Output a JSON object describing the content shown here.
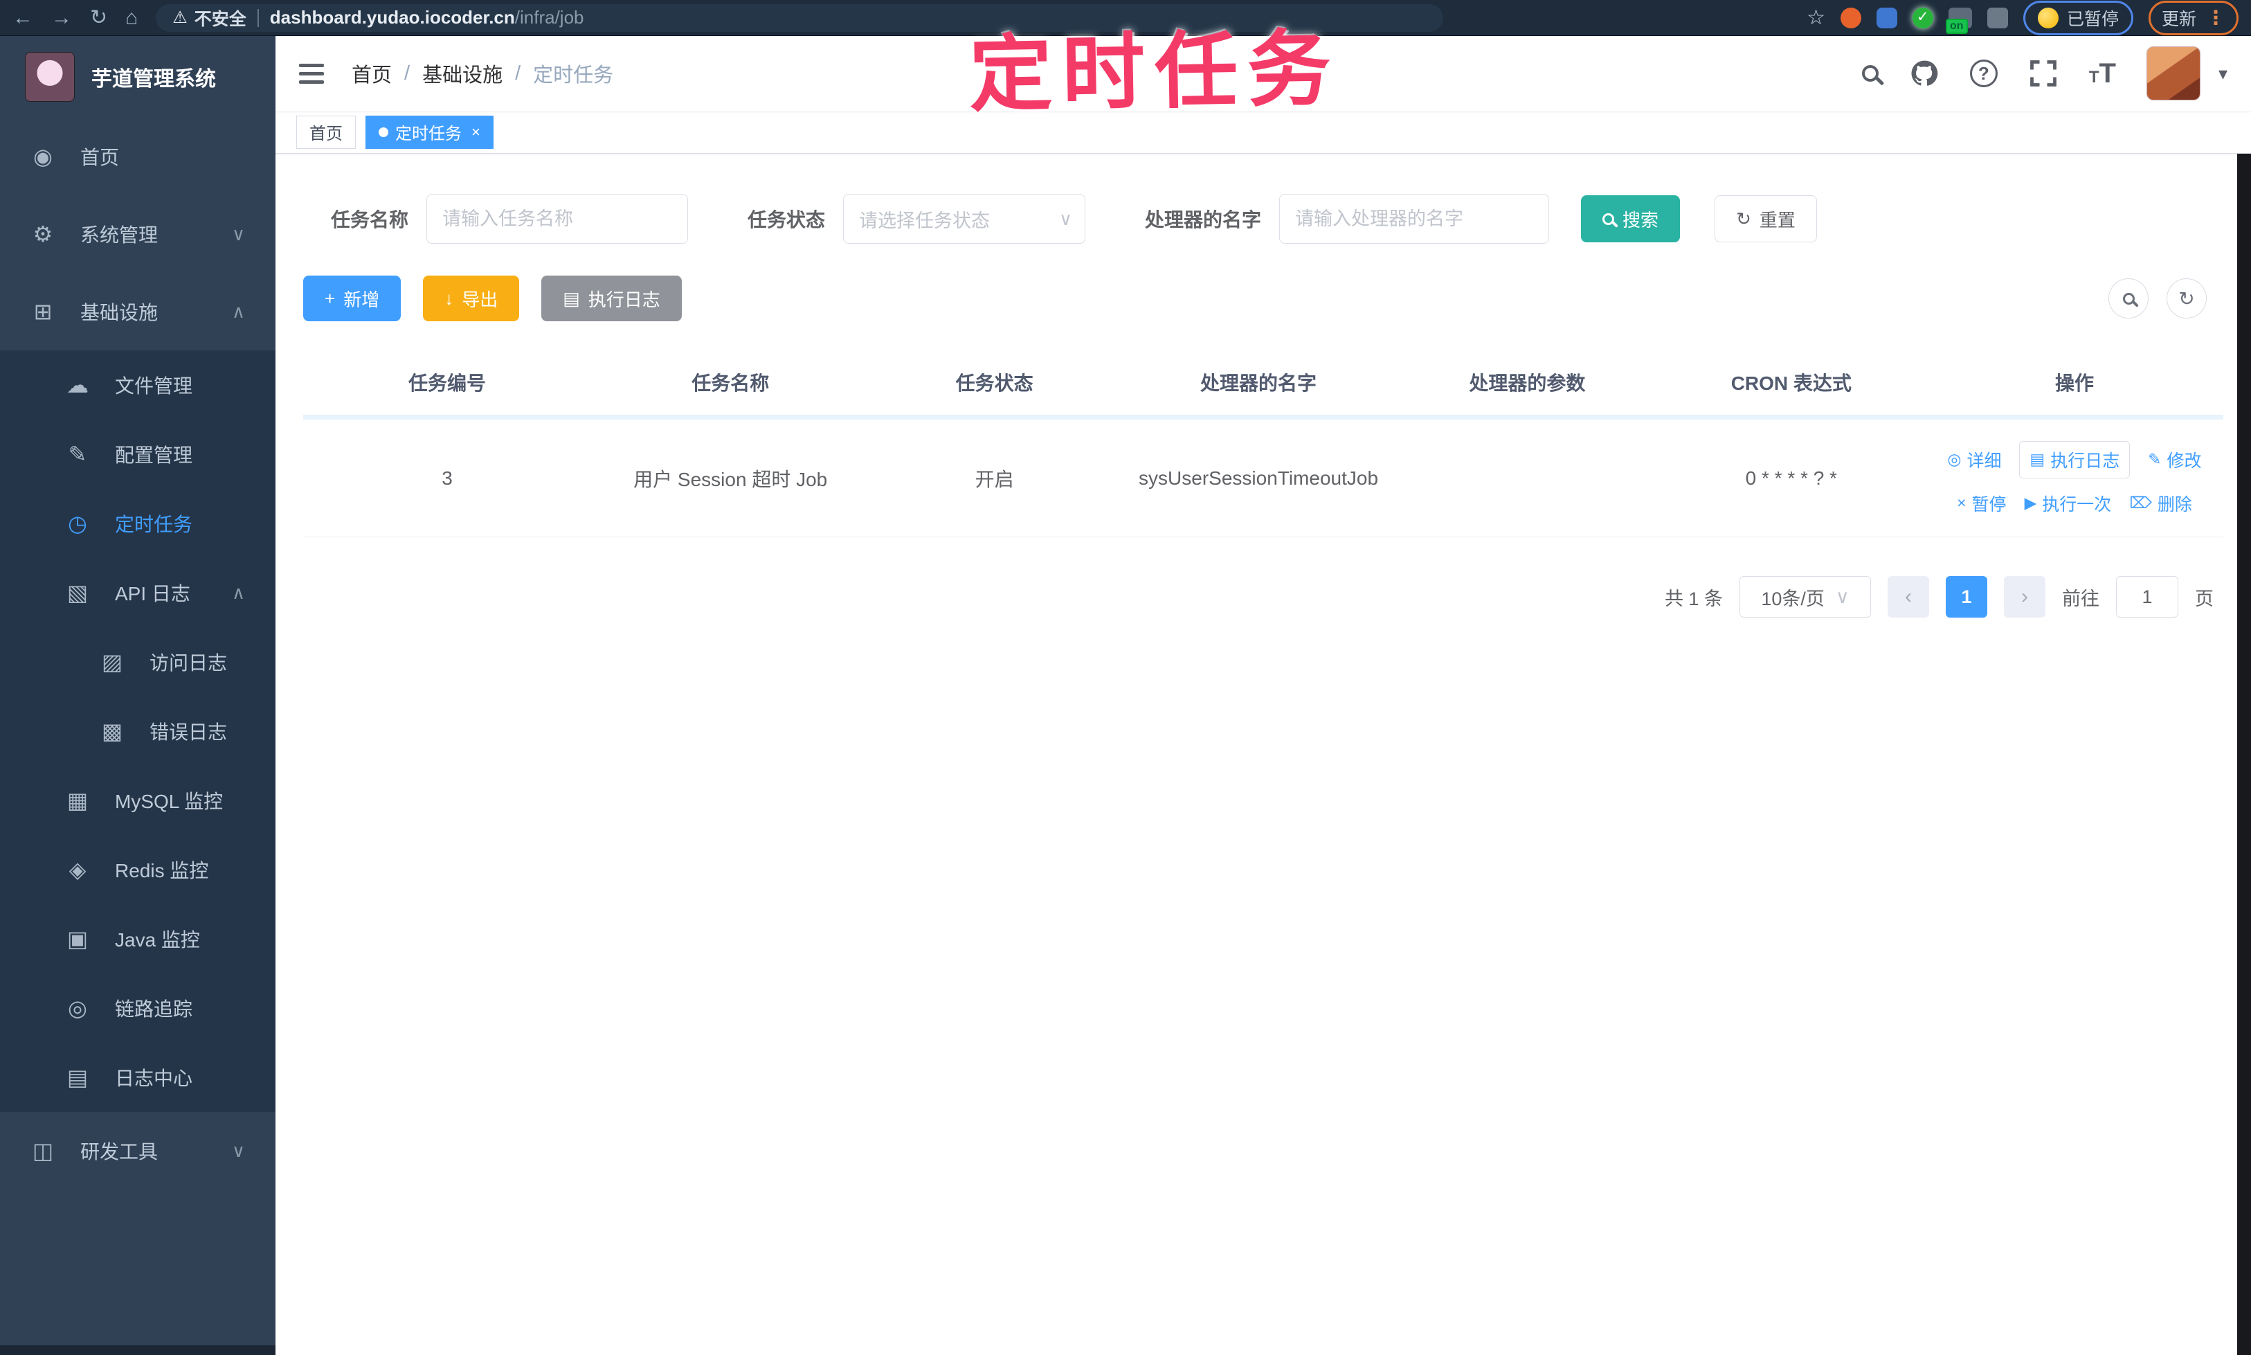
{
  "colors": {
    "accent": "#409EFF",
    "search_teal": "#2AB3A3",
    "export_yellow": "#F9AE13",
    "info_gray": "#909399",
    "annotation_pink": "#F43B68",
    "sidebar_bg": "#304156",
    "submenu_bg": "#253549"
  },
  "browser": {
    "back_icon": "←",
    "forward_icon": "→",
    "reload_icon": "↻",
    "home_icon": "⌂",
    "warning_icon": "⚠",
    "security_label": "不安全",
    "url_host": "dashboard.yudao.iocoder.cn",
    "url_path": "/infra/job",
    "star_icon": "☆",
    "on_badge": "on",
    "paused_label": "已暂停",
    "update_label": "更新",
    "kebab_icon": "⋮"
  },
  "annotation": {
    "title": "定时任务"
  },
  "sidebar": {
    "app_title": "芋道管理系统",
    "items": [
      {
        "label": "首页",
        "icon": "◉"
      },
      {
        "label": "系统管理",
        "icon": "⚙",
        "chevron": "∨"
      },
      {
        "label": "基础设施",
        "icon": "⊞",
        "chevron": "∧"
      },
      {
        "label": "文件管理",
        "icon": "☁"
      },
      {
        "label": "配置管理",
        "icon": "✎"
      },
      {
        "label": "定时任务",
        "icon": "◷"
      },
      {
        "label": "API 日志",
        "icon": "▧",
        "chevron": "∧"
      },
      {
        "label": "访问日志",
        "icon": "▨"
      },
      {
        "label": "错误日志",
        "icon": "▩"
      },
      {
        "label": "MySQL 监控",
        "icon": "▦"
      },
      {
        "label": "Redis 监控",
        "icon": "◈"
      },
      {
        "label": "Java 监控",
        "icon": "▣"
      },
      {
        "label": "链路追踪",
        "icon": "◎"
      },
      {
        "label": "日志中心",
        "icon": "▤"
      },
      {
        "label": "研发工具",
        "icon": "◫",
        "chevron": "∨"
      }
    ]
  },
  "header": {
    "breadcrumb": [
      "首页",
      "基础设施",
      "定时任务"
    ],
    "separator": "/",
    "help_icon": "?",
    "caret_icon": "▾",
    "font_icon_big": "T",
    "font_icon_small": "T"
  },
  "tags": [
    {
      "label": "首页"
    },
    {
      "label": "定时任务",
      "close_icon": "×"
    }
  ],
  "filters": {
    "name_label": "任务名称",
    "name_placeholder": "请输入任务名称",
    "status_label": "任务状态",
    "status_placeholder": "请选择任务状态",
    "select_chevron": "∨",
    "handler_label": "处理器的名字",
    "handler_placeholder": "请输入处理器的名字",
    "search_label": "搜索",
    "reset_label": "重置",
    "reset_icon": "↻"
  },
  "toolbar": {
    "add_label": "新增",
    "add_icon": "+",
    "export_label": "导出",
    "export_icon": "↓",
    "log_label": "执行日志",
    "log_icon": "▤",
    "refresh_icon": "↻"
  },
  "table": {
    "columns": [
      "任务编号",
      "任务名称",
      "任务状态",
      "处理器的名字",
      "处理器的参数",
      "CRON 表达式",
      "操作"
    ],
    "rows": [
      {
        "id": "3",
        "name": "用户 Session 超时 Job",
        "status": "开启",
        "handler": "sysUserSessionTimeoutJob",
        "param": "",
        "cron": "0 * * * * ? *",
        "actions": [
          {
            "label": "详细",
            "icon": "◎"
          },
          {
            "label": "执行日志",
            "icon": "▤"
          },
          {
            "label": "修改",
            "icon": "✎"
          },
          {
            "label": "暂停",
            "icon": "×"
          },
          {
            "label": "执行一次",
            "icon": "▶"
          },
          {
            "label": "删除",
            "icon": "⌦"
          }
        ]
      }
    ]
  },
  "pagination": {
    "total": "共 1 条",
    "page_size": "10条/页",
    "chevron": "∨",
    "prev_icon": "‹",
    "next_icon": "›",
    "current": "1",
    "goto_label": "前往",
    "goto_value": "1",
    "page_label": "页"
  }
}
